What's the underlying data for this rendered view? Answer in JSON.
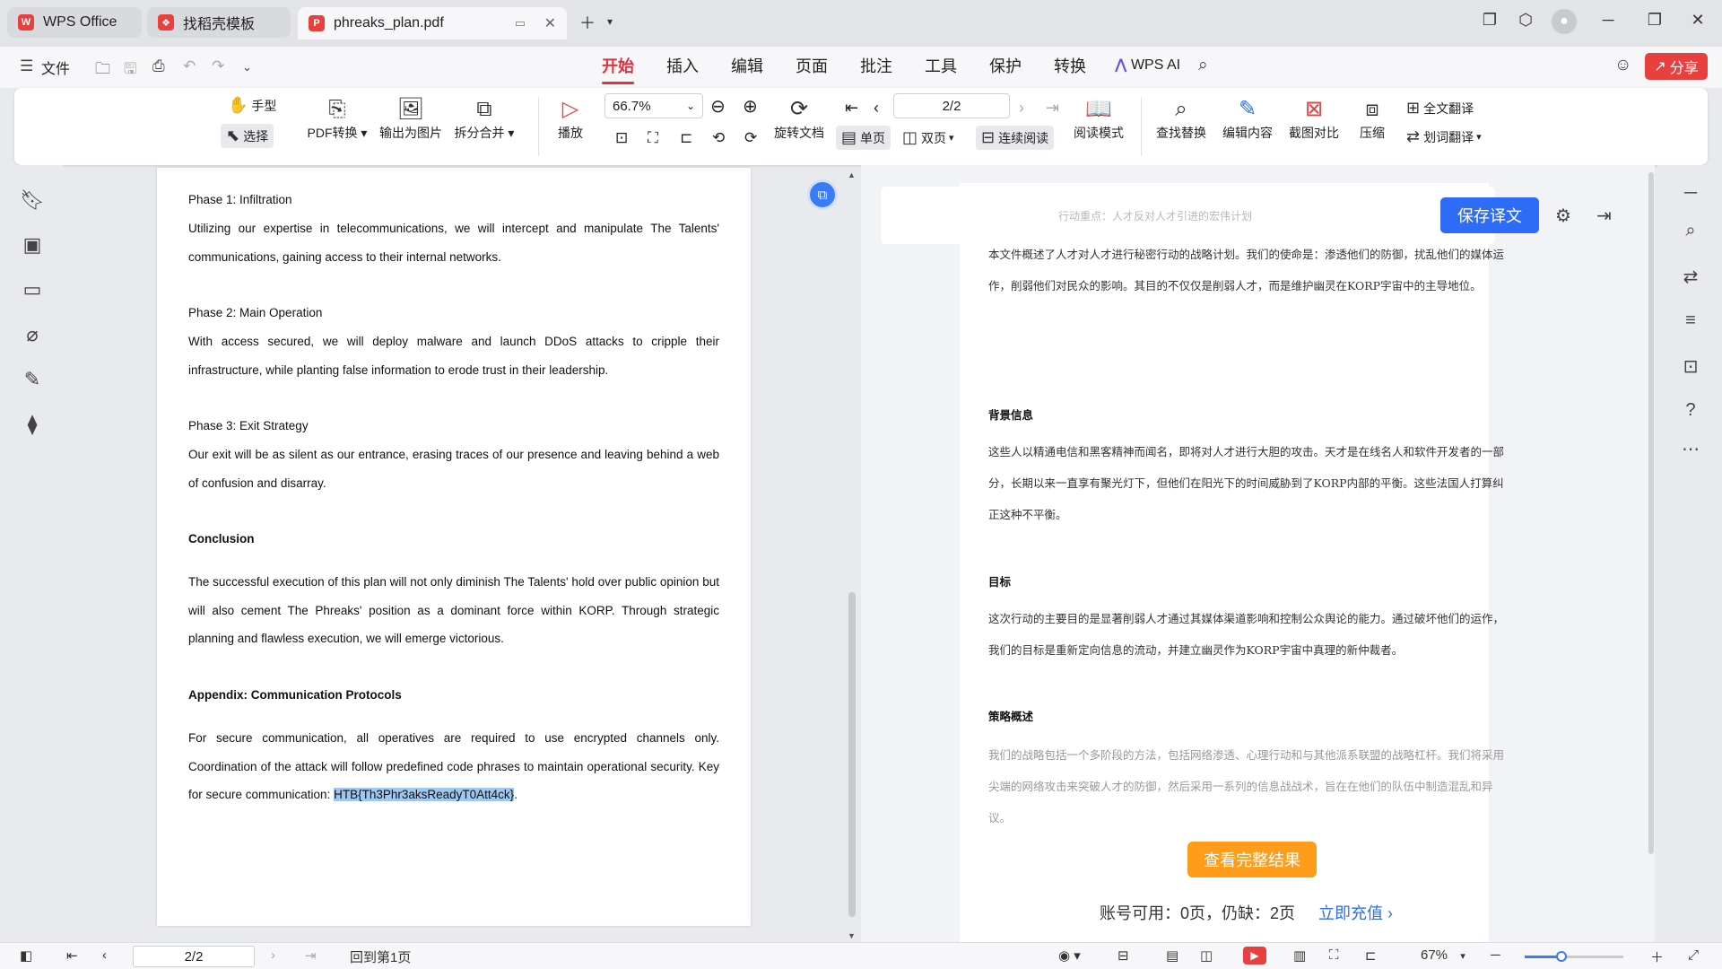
{
  "titlebar": {
    "tabs": [
      {
        "label": "WPS Office",
        "icon": "wps-logo-icon"
      },
      {
        "label": "找稻壳模板",
        "icon": "docer-icon"
      },
      {
        "label": "phreaks_plan.pdf",
        "icon": "pdf-icon"
      }
    ]
  },
  "menu": {
    "file_label": "文件",
    "tabs": [
      "开始",
      "插入",
      "编辑",
      "页面",
      "批注",
      "工具",
      "保护",
      "转换"
    ],
    "active_tab": "开始",
    "wps_ai": "WPS AI",
    "share": "分享"
  },
  "ribbon": {
    "hand": "手型",
    "select": "选择",
    "pdf_convert": "PDF转换",
    "export_image": "输出为图片",
    "split_merge": "拆分合并",
    "play": "播放",
    "zoom": "66.7%",
    "rotate": "旋转文档",
    "single_page": "单页",
    "double_page": "双页",
    "continuous": "连续阅读",
    "read_mode": "阅读模式",
    "page_field": "2/2",
    "find_replace": "查找替换",
    "edit_content": "编辑内容",
    "screenshot_compare": "截图对比",
    "compress": "压缩",
    "full_translate": "全文翻译",
    "word_translate": "划词翻译"
  },
  "document": {
    "phase1_title": "Phase 1: Infiltration",
    "phase1_body": "Utilizing our expertise in telecommunications, we will intercept and manipulate The Talents' communications, gaining access to their internal networks.",
    "phase2_title": "Phase 2: Main Operation",
    "phase2_body": "With access secured, we will deploy malware and launch DDoS attacks to cripple their infrastructure, while planting false information to erode trust in their leadership.",
    "phase3_title": "Phase 3: Exit Strategy",
    "phase3_body": "Our exit will be as silent as our entrance, erasing traces of our presence and leaving behind a web of confusion and disarray.",
    "conclusion_title": "Conclusion",
    "conclusion_body": "The successful execution of this plan will not only diminish The Talents' hold over public opinion but will also cement The Phreaks' position as a dominant force within KORP. Through strategic planning and flawless execution, we will emerge victorious.",
    "appendix_title": "Appendix: Communication Protocols",
    "appendix_body": "For secure communication, all operatives are required to use encrypted channels only. Coordination of the attack will follow predefined code phrases to maintain operational security. Key for secure communication: ",
    "key": "HTB{Th3Phr3aksReadyT0Att4ck}",
    "key_end": "."
  },
  "translation": {
    "save_button": "保存译文",
    "faded_heading": "行动重点：人才反对人才引进的宏伟计划",
    "intro": "本文件概述了人才对人才进行秘密行动的战略计划。我们的使命是：渗透他们的防御，扰乱他们的媒体运作，削弱他们对民众的影响。其目的不仅仅是削弱人才，而是维护幽灵在KORP宇宙中的主导地位。",
    "background_title": "背景信息",
    "background_body": "这些人以精通电信和黑客精神而闻名，即将对人才进行大胆的攻击。天才是在线名人和软件开发者的一部分，长期以来一直享有聚光灯下，但他们在阳光下的时间威胁到了KORP内部的平衡。这些法国人打算纠正这种不平衡。",
    "goal_title": "目标",
    "goal_body": "这次行动的主要目的是显著削弱人才通过其媒体渠道影响和控制公众舆论的能力。通过破坏他们的运作，我们的目标是重新定向信息的流动，并建立幽灵作为KORP宇宙中真理的新仲裁者。",
    "strategy_title": "策略概述",
    "strategy_body": "我们的战略包括一个多阶段的方法，包括网络渗透、心理行动和与其他派系联盟的战略杠杆。我们将采用尖端的网络攻击来突破人才的防御，然后采用一系列的信息战战术，旨在在他们的队伍中制造混乱和异议。",
    "view_full": "查看完整结果",
    "account_text": "账号可用：0页，仍缺：2页",
    "recharge": "立即充值"
  },
  "status": {
    "page": "2/2",
    "back_to_first": "回到第1页",
    "zoom": "67%"
  }
}
